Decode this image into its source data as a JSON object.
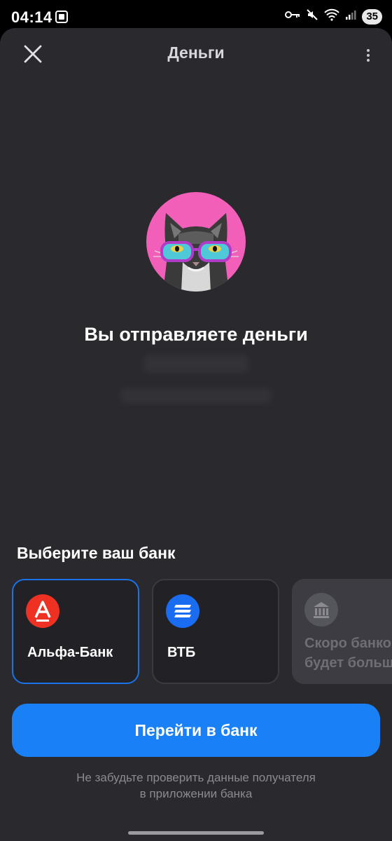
{
  "status_bar": {
    "time": "04:14",
    "battery": "35"
  },
  "header": {
    "title": "Деньги"
  },
  "hero": {
    "text": "Вы отправляете деньги"
  },
  "bank_section": {
    "title": "Выберите ваш банк",
    "banks": [
      {
        "name": "Альфа-Банк",
        "logo_letter": "А",
        "color": "#ef3124",
        "selected": true
      },
      {
        "name": "ВТБ",
        "color": "#1a6cf0",
        "selected": false
      }
    ],
    "soon_line1": "Скоро банков",
    "soon_line2": "будет больше"
  },
  "actions": {
    "go_button": "Перейти в банк"
  },
  "hint": {
    "line1": "Не забудьте проверить данные получателя",
    "line2": "в приложении банка"
  }
}
